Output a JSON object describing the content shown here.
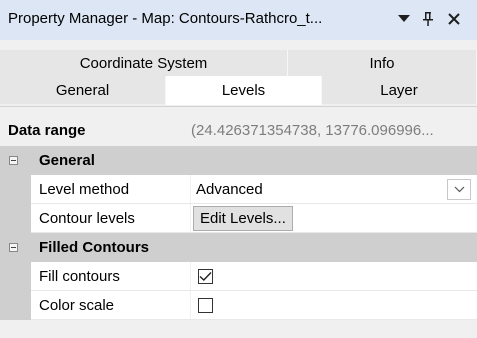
{
  "window": {
    "title": "Property Manager - Map: Contours-Rathcro_t...",
    "buttons": {
      "menu_icon": "chevron-down-icon",
      "pin_icon": "pin-icon",
      "close_icon": "close-icon"
    }
  },
  "tabs": {
    "row1": [
      {
        "label": "Coordinate System"
      },
      {
        "label": "Info"
      }
    ],
    "row2": [
      {
        "label": "General"
      },
      {
        "label": "Levels",
        "active": true
      },
      {
        "label": "Layer"
      }
    ]
  },
  "grid": {
    "data_range": {
      "label": "Data range",
      "value": "(24.426371354738, 13776.096996..."
    },
    "general": {
      "label": "General",
      "level_method": {
        "label": "Level method",
        "value": "Advanced"
      },
      "contour_levels": {
        "label": "Contour levels",
        "button_label": "Edit Levels..."
      }
    },
    "filled_contours": {
      "label": "Filled Contours",
      "fill_contours": {
        "label": "Fill contours",
        "checked": true
      },
      "color_scale": {
        "label": "Color scale",
        "checked": false
      }
    }
  },
  "colors": {
    "titlebar": "#dce6f4",
    "category": "#cfcfcf",
    "tab_inactive": "#e6e6e6",
    "tab_active": "#ffffff"
  }
}
